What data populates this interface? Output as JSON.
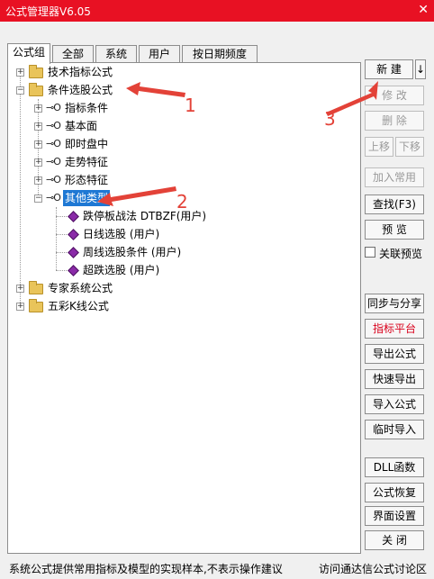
{
  "window": {
    "title": "公式管理器V6.05",
    "close_glyph": "✕"
  },
  "tabs": [
    {
      "label": "公式组",
      "active": true
    },
    {
      "label": "全部",
      "active": false
    },
    {
      "label": "系统",
      "active": false
    },
    {
      "label": "用户",
      "active": false
    },
    {
      "label": "按日期频度",
      "active": false
    }
  ],
  "tree": {
    "n0": "技术指标公式",
    "n1": "条件选股公式",
    "n1_children": [
      "指标条件",
      "基本面",
      "即时盘中",
      "走势特征",
      "形态特征",
      "其他类型"
    ],
    "n1_5_children": [
      "跌停板战法 DTBZF(用户)",
      "日线选股 (用户)",
      "周线选股条件 (用户)",
      "超跌选股 (用户)"
    ],
    "n2": "专家系统公式",
    "n3": "五彩K线公式"
  },
  "buttons": {
    "new": "新  建",
    "new_dropdown": "↓",
    "modify": "修  改",
    "delete": "删  除",
    "move_up": "上移",
    "move_down": "下移",
    "add_common": "加入常用",
    "find": "查找(F3)",
    "preview": "预  览",
    "linked_preview": "关联预览",
    "sync_share": "同步与分享",
    "indicator_platform": "指标平台",
    "export": "导出公式",
    "quick_export": "快速导出",
    "import": "导入公式",
    "temp_import": "临时导入",
    "dll": "DLL函数",
    "restore": "公式恢复",
    "ui_settings": "界面设置",
    "close": "关  闭"
  },
  "status": {
    "left": "系统公式提供常用指标及模型的实现样本,不表示操作建议",
    "right": "访问通达信公式讨论区"
  },
  "annotations": [
    "1",
    "2",
    "3"
  ],
  "colors": {
    "title_bar": "#e81123",
    "selection": "#1e78d4",
    "annotation": "#e34238",
    "red_text": "#d9001b"
  }
}
